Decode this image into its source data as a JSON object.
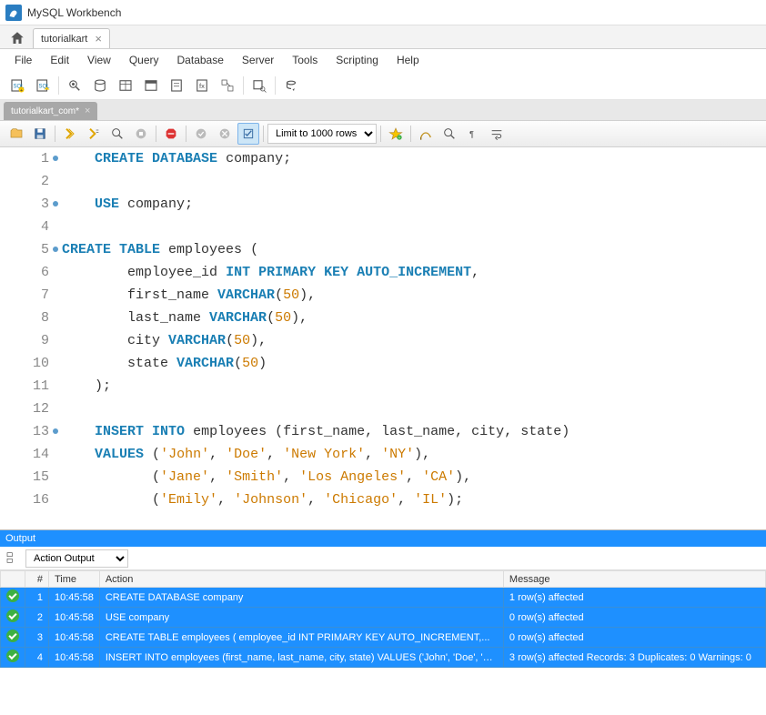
{
  "window": {
    "title": "MySQL Workbench"
  },
  "conn_tab": {
    "label": "tutorialkart"
  },
  "menu": [
    "File",
    "Edit",
    "View",
    "Query",
    "Database",
    "Server",
    "Tools",
    "Scripting",
    "Help"
  ],
  "sql_tab": {
    "label": "tutorialkart_com*"
  },
  "editor_toolbar": {
    "limit_label": "Limit to 1000 rows"
  },
  "code_lines": [
    {
      "n": 1,
      "dot": true,
      "tokens": [
        [
          "sp",
          "    "
        ],
        [
          "kw",
          "CREATE DATABASE"
        ],
        [
          "sp",
          " "
        ],
        [
          "id",
          "company"
        ],
        [
          "pn",
          ";"
        ]
      ]
    },
    {
      "n": 2,
      "dot": false,
      "tokens": []
    },
    {
      "n": 3,
      "dot": true,
      "tokens": [
        [
          "sp",
          "    "
        ],
        [
          "kw",
          "USE"
        ],
        [
          "sp",
          " "
        ],
        [
          "id",
          "company"
        ],
        [
          "pn",
          ";"
        ]
      ]
    },
    {
      "n": 4,
      "dot": false,
      "tokens": []
    },
    {
      "n": 5,
      "dot": true,
      "tokens": [
        [
          "kw",
          "CREATE TABLE"
        ],
        [
          "sp",
          " "
        ],
        [
          "id",
          "employees"
        ],
        [
          "sp",
          " "
        ],
        [
          "pn",
          "("
        ]
      ]
    },
    {
      "n": 6,
      "dot": false,
      "tokens": [
        [
          "sp",
          "        "
        ],
        [
          "id",
          "employee_id"
        ],
        [
          "sp",
          " "
        ],
        [
          "ty",
          "INT PRIMARY KEY AUTO_INCREMENT"
        ],
        [
          "pn",
          ","
        ]
      ]
    },
    {
      "n": 7,
      "dot": false,
      "tokens": [
        [
          "sp",
          "        "
        ],
        [
          "id",
          "first_name"
        ],
        [
          "sp",
          " "
        ],
        [
          "ty",
          "VARCHAR"
        ],
        [
          "pn",
          "("
        ],
        [
          "num",
          "50"
        ],
        [
          "pn",
          "),"
        ]
      ]
    },
    {
      "n": 8,
      "dot": false,
      "tokens": [
        [
          "sp",
          "        "
        ],
        [
          "id",
          "last_name"
        ],
        [
          "sp",
          " "
        ],
        [
          "ty",
          "VARCHAR"
        ],
        [
          "pn",
          "("
        ],
        [
          "num",
          "50"
        ],
        [
          "pn",
          "),"
        ]
      ]
    },
    {
      "n": 9,
      "dot": false,
      "tokens": [
        [
          "sp",
          "        "
        ],
        [
          "id",
          "city"
        ],
        [
          "sp",
          " "
        ],
        [
          "ty",
          "VARCHAR"
        ],
        [
          "pn",
          "("
        ],
        [
          "num",
          "50"
        ],
        [
          "pn",
          "),"
        ]
      ]
    },
    {
      "n": 10,
      "dot": false,
      "tokens": [
        [
          "sp",
          "        "
        ],
        [
          "id",
          "state"
        ],
        [
          "sp",
          " "
        ],
        [
          "ty",
          "VARCHAR"
        ],
        [
          "pn",
          "("
        ],
        [
          "num",
          "50"
        ],
        [
          "pn",
          ")"
        ]
      ]
    },
    {
      "n": 11,
      "dot": false,
      "tokens": [
        [
          "sp",
          "    "
        ],
        [
          "pn",
          ");"
        ]
      ]
    },
    {
      "n": 12,
      "dot": false,
      "tokens": []
    },
    {
      "n": 13,
      "dot": true,
      "tokens": [
        [
          "sp",
          "    "
        ],
        [
          "kw",
          "INSERT INTO"
        ],
        [
          "sp",
          " "
        ],
        [
          "id",
          "employees"
        ],
        [
          "sp",
          " "
        ],
        [
          "pn",
          "("
        ],
        [
          "id",
          "first_name"
        ],
        [
          "pn",
          ", "
        ],
        [
          "id",
          "last_name"
        ],
        [
          "pn",
          ", "
        ],
        [
          "id",
          "city"
        ],
        [
          "pn",
          ", "
        ],
        [
          "id",
          "state"
        ],
        [
          "pn",
          ")"
        ]
      ]
    },
    {
      "n": 14,
      "dot": false,
      "tokens": [
        [
          "sp",
          "    "
        ],
        [
          "kw",
          "VALUES"
        ],
        [
          "sp",
          " "
        ],
        [
          "pn",
          "("
        ],
        [
          "str",
          "'John'"
        ],
        [
          "pn",
          ", "
        ],
        [
          "str",
          "'Doe'"
        ],
        [
          "pn",
          ", "
        ],
        [
          "str",
          "'New York'"
        ],
        [
          "pn",
          ", "
        ],
        [
          "str",
          "'NY'"
        ],
        [
          "pn",
          "),"
        ]
      ]
    },
    {
      "n": 15,
      "dot": false,
      "tokens": [
        [
          "sp",
          "           "
        ],
        [
          "pn",
          "("
        ],
        [
          "str",
          "'Jane'"
        ],
        [
          "pn",
          ", "
        ],
        [
          "str",
          "'Smith'"
        ],
        [
          "pn",
          ", "
        ],
        [
          "str",
          "'Los Angeles'"
        ],
        [
          "pn",
          ", "
        ],
        [
          "str",
          "'CA'"
        ],
        [
          "pn",
          "),"
        ]
      ]
    },
    {
      "n": 16,
      "dot": false,
      "tokens": [
        [
          "sp",
          "           "
        ],
        [
          "pn",
          "("
        ],
        [
          "str",
          "'Emily'"
        ],
        [
          "pn",
          ", "
        ],
        [
          "str",
          "'Johnson'"
        ],
        [
          "pn",
          ", "
        ],
        [
          "str",
          "'Chicago'"
        ],
        [
          "pn",
          ", "
        ],
        [
          "str",
          "'IL'"
        ],
        [
          "pn",
          ");"
        ]
      ]
    }
  ],
  "output": {
    "header": "Output",
    "mode": "Action Output",
    "columns": [
      "",
      "#",
      "Time",
      "Action",
      "Message"
    ],
    "rows": [
      {
        "n": "1",
        "time": "10:45:58",
        "action": "CREATE DATABASE company",
        "msg": "1 row(s) affected"
      },
      {
        "n": "2",
        "time": "10:45:58",
        "action": "USE company",
        "msg": "0 row(s) affected"
      },
      {
        "n": "3",
        "time": "10:45:58",
        "action": "CREATE TABLE employees (     employee_id INT PRIMARY KEY AUTO_INCREMENT,...",
        "msg": "0 row(s) affected"
      },
      {
        "n": "4",
        "time": "10:45:58",
        "action": "INSERT INTO employees (first_name, last_name, city, state) VALUES ('John', 'Doe', 'Ne...",
        "msg": "3 row(s) affected Records: 3  Duplicates: 0  Warnings: 0"
      }
    ]
  }
}
